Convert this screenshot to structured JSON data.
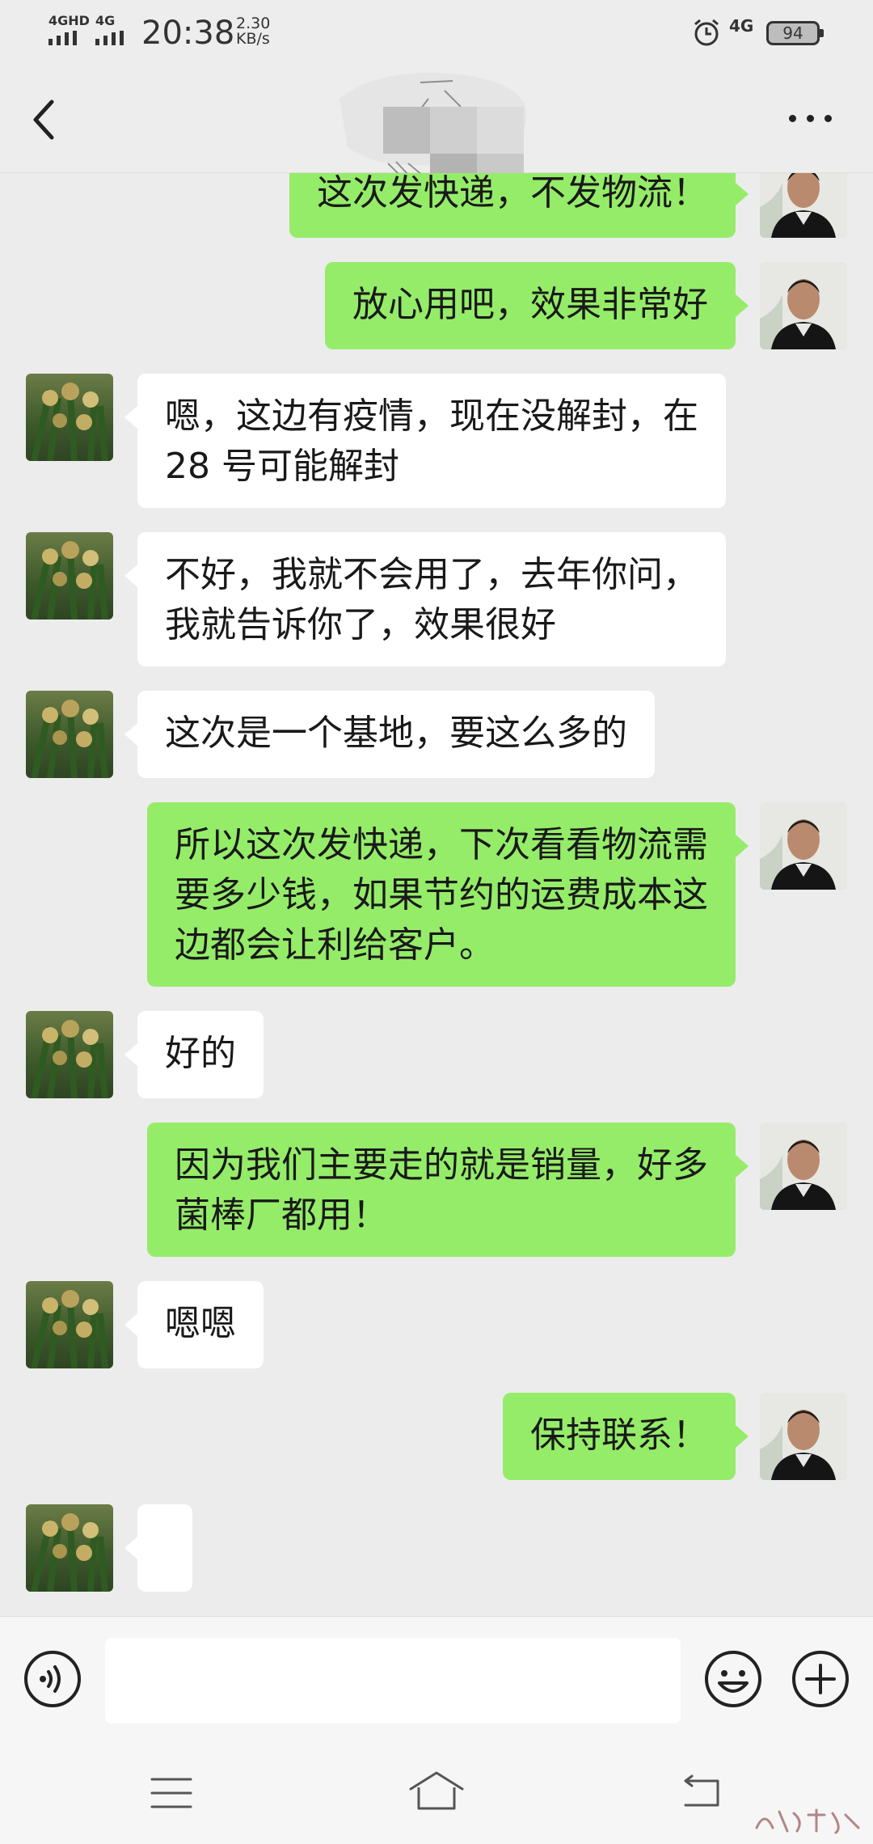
{
  "status_bar": {
    "net1": "4GHD",
    "net2": "4G",
    "time": "20:38",
    "speed_value": "2.30",
    "speed_unit": "KB/s",
    "net_right": "4G",
    "battery": "94"
  },
  "title_bar": {
    "back_icon": "chevron-left-icon",
    "more_icon": "more-dots-icon"
  },
  "messages": [
    {
      "side": "out",
      "lines": [
        "这次发快递，不发物流！"
      ]
    },
    {
      "side": "out",
      "lines": [
        "放心用吧，效果非常好"
      ]
    },
    {
      "side": "in",
      "lines": [
        "嗯，这边有疫情，现在没解封，在",
        "28 号可能解封"
      ]
    },
    {
      "side": "in",
      "lines": [
        "不好，我就不会用了，去年你问，",
        "我就告诉你了，效果很好"
      ]
    },
    {
      "side": "in",
      "lines": [
        "这次是一个基地，要这么多的"
      ]
    },
    {
      "side": "out",
      "lines": [
        "所以这次发快递，下次看看物流需",
        "要多少钱，如果节约的运费成本这",
        "边都会让利给客户。"
      ]
    },
    {
      "side": "in",
      "lines": [
        "好的"
      ]
    },
    {
      "side": "out",
      "lines": [
        "因为我们主要走的就是销量，好多",
        "菌棒厂都用！"
      ]
    },
    {
      "side": "in",
      "lines": [
        "嗯嗯"
      ]
    },
    {
      "side": "out",
      "lines": [
        "保持联系！"
      ]
    },
    {
      "side": "in",
      "lines": [
        ""
      ]
    }
  ],
  "input_bar": {
    "voice_icon": "voice-icon",
    "text_value": "",
    "emoji_icon": "emoji-icon",
    "plus_icon": "plus-icon"
  },
  "nav_bar": {
    "menu_icon": "menu-icon",
    "home_icon": "home-icon",
    "back_icon": "back-icon"
  },
  "colors": {
    "outgoing_bubble": "#95ec69",
    "incoming_bubble": "#ffffff",
    "background": "#ececec"
  }
}
